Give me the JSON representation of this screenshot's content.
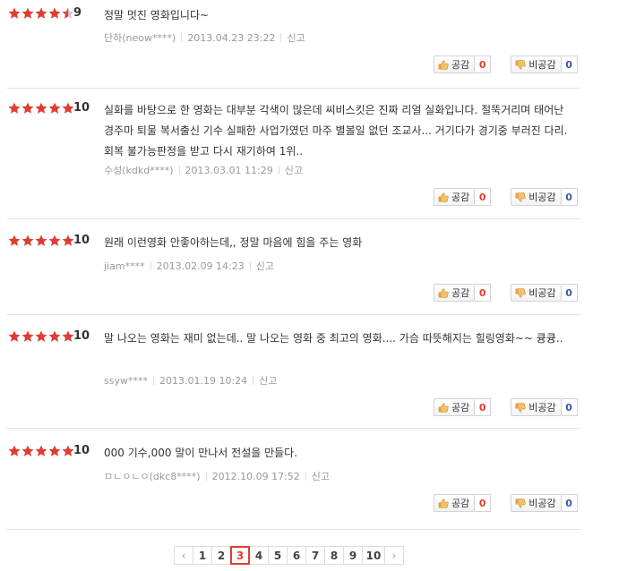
{
  "labels": {
    "like": "공감",
    "dislike": "비공감",
    "report": "신고"
  },
  "colors": {
    "star": "#e03c31",
    "star_empty": "#c9c9c9",
    "like_count": "#e03c31",
    "dislike_count": "#3d5a99",
    "current_page": "#e03c31"
  },
  "reviews": [
    {
      "rating": 9,
      "score": "9",
      "comment": "정말 멋진 영화입니다~",
      "user": "단하(neow****)",
      "date": "2013.04.23 23:22",
      "likes": "0",
      "dislikes": "0"
    },
    {
      "rating": 10,
      "score": "10",
      "comment": "실화를 바탕으로 한 영화는 대부분 각색이 많은데 씨비스킷은 진짜 리얼 실화입니다. 절뚝거리며 태어난 경주마 퇴물 복서출신 기수 실패한 사업가였던 마주 별볼일 없던 조교사... 거기다가 경기중 부러진 다리. 회복 불가능판정을 받고 다시 재기하여 1위..",
      "user": "수성(kdkd****)",
      "date": "2013.03.01 11:29",
      "likes": "0",
      "dislikes": "0"
    },
    {
      "rating": 10,
      "score": "10",
      "comment": "원래 이런영화 안좋아하는데,, 정말 마음에 힘을 주는 영화",
      "user": "jiam****",
      "date": "2013.02.09 14:23",
      "likes": "0",
      "dislikes": "0"
    },
    {
      "rating": 10,
      "score": "10",
      "comment": "말 나오는 영화는 재미 없는데.. 말 나오는 영화 중 최고의 영화.... 가슴 따뜻해지는 힐링영화~~ 큥큥..",
      "user": "ssyw****",
      "date": "2013.01.19 10:24",
      "likes": "0",
      "dislikes": "0"
    },
    {
      "rating": 10,
      "score": "10",
      "comment": "000 기수,000 말이 만나서 전설을 만들다.",
      "user": "ㅁㄴㅇㄴㅇ(dkc8****)",
      "date": "2012.10.09 17:52",
      "likes": "0",
      "dislikes": "0"
    }
  ],
  "pagination": {
    "prev": "‹",
    "next": "›",
    "pages": [
      "1",
      "2",
      "3",
      "4",
      "5",
      "6",
      "7",
      "8",
      "9",
      "10"
    ],
    "current": "3"
  }
}
